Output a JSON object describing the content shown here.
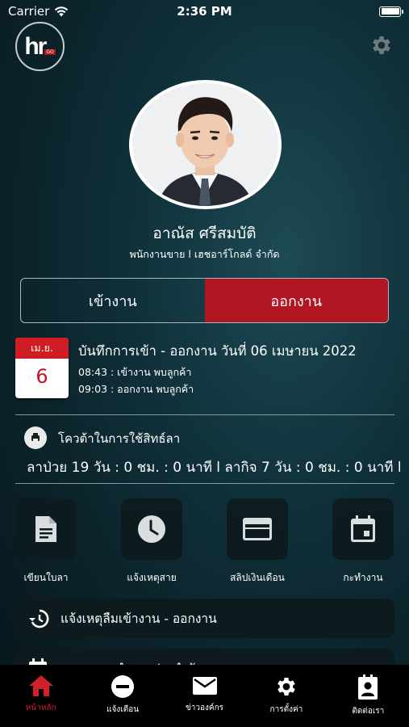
{
  "status_bar": {
    "carrier": "Carrier",
    "time": "2:36 PM"
  },
  "logo": {
    "text": "hr",
    "badge": "GO"
  },
  "profile": {
    "name": "อาณัส ศรีสมบัติ",
    "position": "พนักงานขาย l เฮชอาร์โกลด์ จำกัด"
  },
  "segment": {
    "check_in": "เข้างาน",
    "check_out": "ออกงาน"
  },
  "record": {
    "calendar_month": "เม.ย.",
    "calendar_day": "6",
    "title": "บันทึกการเข้า - ออกงาน วันที่ 06 เมษายน 2022",
    "line1": "08:43 : เข้างาน  พบลูกค้า",
    "line2": "09:03 : ออกงาน  พบลูกค้า"
  },
  "quota": {
    "title": "โควต้าในการใช้สิทธ์ลา",
    "detail": "ลาป่วย 19 วัน : 0 ชม. : 0 นาที  l ลากิจ 7 วัน : 0 ชม. : 0 นาที  l"
  },
  "menu": [
    {
      "label": "เขียนใบลา",
      "icon": "document-icon"
    },
    {
      "label": "แจ้งเหตุสาย",
      "icon": "clock-icon"
    },
    {
      "label": "สลิปเงินเดือน",
      "icon": "credit-card-icon"
    },
    {
      "label": "กะทำงาน",
      "icon": "calendar-icon"
    }
  ],
  "actions": {
    "forgot_label": "แจ้งเหตุลืมเข้างาน - ออกงาน",
    "second_label": "ตารางการทำงานประจำวัน"
  },
  "tabs": [
    {
      "label": "หน้าหลัก",
      "icon": "home-icon"
    },
    {
      "label": "แจ้งเตือน",
      "icon": "minus-circle-icon"
    },
    {
      "label": "ข่าวองค์กร",
      "icon": "mail-icon"
    },
    {
      "label": "การตั้งค่า",
      "icon": "gear-icon"
    },
    {
      "label": "ติดต่อเรา",
      "icon": "contact-icon"
    }
  ],
  "colors": {
    "accent": "#b21623",
    "active_tab": "#d0202a",
    "background": "#0f2f38"
  }
}
